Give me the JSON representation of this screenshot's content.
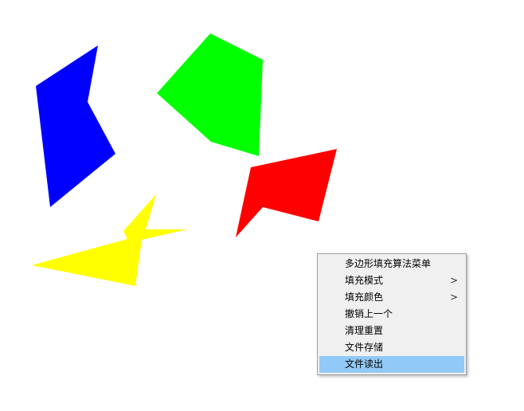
{
  "canvas": {
    "shapes": [
      {
        "name": "blue-polygon",
        "color": "#0000ff"
      },
      {
        "name": "green-polygon",
        "color": "#00ff00"
      },
      {
        "name": "red-polygon",
        "color": "#ff0000"
      },
      {
        "name": "yellow-polygon",
        "color": "#ffff00"
      }
    ]
  },
  "context_menu": {
    "items": [
      {
        "label": "多边形填充算法菜单",
        "submenu": false
      },
      {
        "label": "填充模式",
        "submenu": true,
        "arrow": ">"
      },
      {
        "label": "填充颜色",
        "submenu": true,
        "arrow": ">"
      },
      {
        "label": "撤销上一个",
        "submenu": false
      },
      {
        "label": "清理重置",
        "submenu": false
      },
      {
        "label": "文件存储",
        "submenu": false
      },
      {
        "label": "文件读出",
        "submenu": false,
        "highlighted": true
      }
    ],
    "highlight_color": "#91c9f7"
  }
}
